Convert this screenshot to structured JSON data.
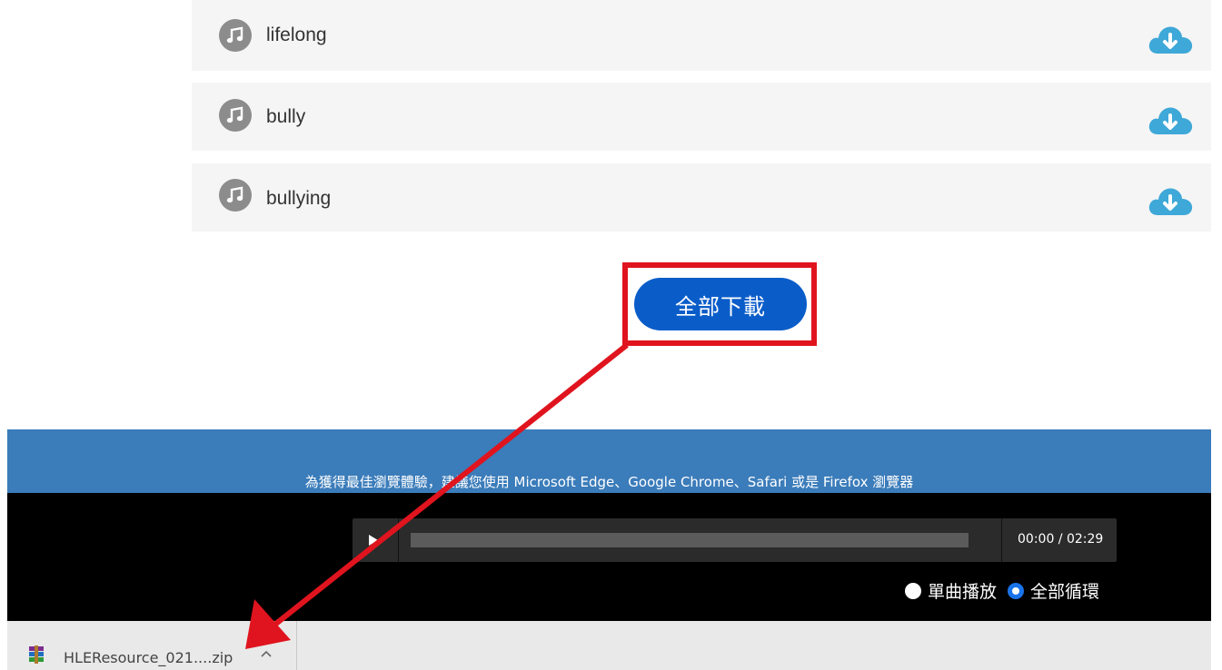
{
  "tracks": [
    {
      "title": "lifelong"
    },
    {
      "title": "bully"
    },
    {
      "title": "bullying"
    }
  ],
  "download_all": {
    "label": "全部下載"
  },
  "footer": {
    "browser_note": "為獲得最佳瀏覽體驗，建議您使用 Microsoft Edge、Google Chrome、Safari 或是 Firefox 瀏覽器"
  },
  "player": {
    "time": "00:00 / 02:29"
  },
  "play_modes": {
    "single": "單曲播放",
    "loop_all": "全部循環",
    "selected": "loop_all"
  },
  "downloads_bar": {
    "filename": "HLEResource_021....zip"
  },
  "colors": {
    "accent_blue": "#0a5dc9",
    "highlight_red": "#e0141e",
    "footer_blue": "#3b7cba",
    "cloud_blue": "#3ea8d8"
  }
}
